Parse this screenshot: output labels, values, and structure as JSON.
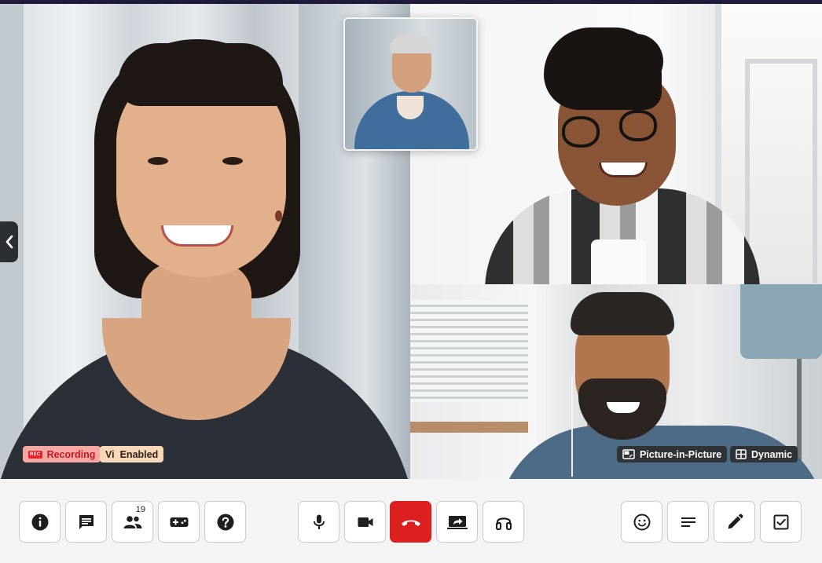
{
  "participants": [
    {
      "role": "main-speaker"
    },
    {
      "role": "top-right"
    },
    {
      "role": "bottom-right"
    },
    {
      "role": "picture-in-picture"
    }
  ],
  "badges": {
    "recording": {
      "icon_text": "REC",
      "label": "Recording"
    },
    "vi": {
      "icon_text": "Vi",
      "label": "Enabled"
    },
    "pip": {
      "label": "Picture-in-Picture"
    },
    "dynamic": {
      "label": "Dynamic"
    }
  },
  "toolbar": {
    "left": [
      {
        "icon": "info-icon"
      },
      {
        "icon": "chat-icon"
      },
      {
        "icon": "participants-icon",
        "count": "19"
      },
      {
        "icon": "gamepad-icon"
      },
      {
        "icon": "help-icon"
      }
    ],
    "center": [
      {
        "icon": "microphone-icon"
      },
      {
        "icon": "camera-icon"
      },
      {
        "icon": "hang-up-icon"
      },
      {
        "icon": "screen-share-icon"
      },
      {
        "icon": "headphones-icon"
      }
    ],
    "right": [
      {
        "icon": "emoji-icon"
      },
      {
        "icon": "captions-icon"
      },
      {
        "icon": "pencil-icon"
      },
      {
        "icon": "checklist-icon"
      }
    ]
  },
  "colors": {
    "end_call": "#dc1f1f",
    "recording_badge": "#f6a7a3",
    "vi_badge": "#f6d7b8",
    "dark_badge": "#2f3236"
  }
}
